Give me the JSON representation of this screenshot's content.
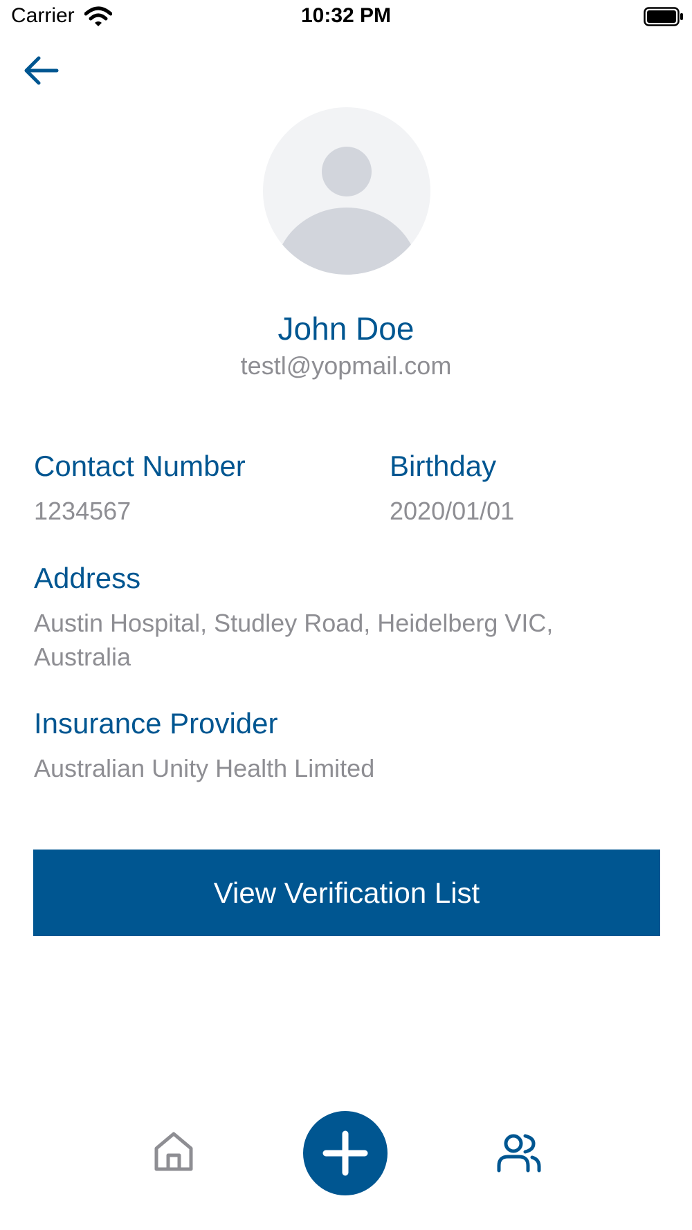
{
  "status_bar": {
    "carrier": "Carrier",
    "time": "10:32 PM"
  },
  "profile": {
    "name": "John Doe",
    "email": "testl@yopmail.com"
  },
  "fields": {
    "contact_label": "Contact Number",
    "contact_value": "1234567",
    "birthday_label": "Birthday",
    "birthday_value": "2020/01/01",
    "address_label": "Address",
    "address_line1": "Austin Hospital, Studley Road, Heidelberg VIC,",
    "address_line2": "Australia",
    "insurance_label": "Insurance Provider",
    "insurance_value": "Australian Unity Health Limited"
  },
  "actions": {
    "view_verification": "View Verification List"
  },
  "icons": {
    "back": "back-arrow-icon",
    "home": "home-icon",
    "add": "plus-icon",
    "users": "users-icon"
  },
  "colors": {
    "accent": "#005691",
    "secondary_text": "#8e8e93",
    "inactive_icon": "#8e8e93"
  }
}
